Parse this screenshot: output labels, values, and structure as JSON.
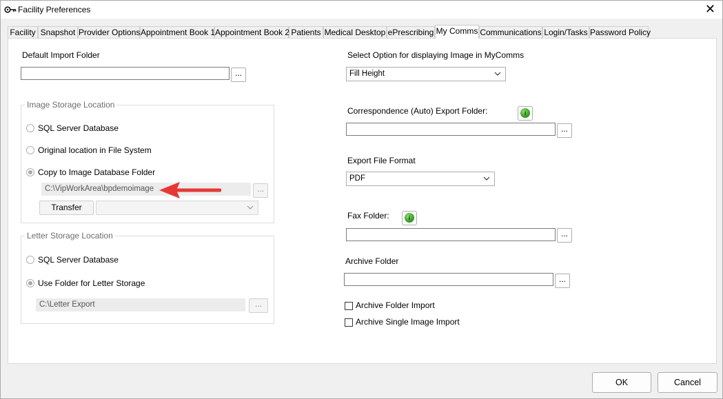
{
  "window": {
    "title": "Facility Preferences"
  },
  "tabs": [
    {
      "label": "Facility"
    },
    {
      "label": "Snapshot"
    },
    {
      "label": "Provider Options"
    },
    {
      "label": "Appointment Book 1"
    },
    {
      "label": "Appointment Book 2"
    },
    {
      "label": "Patients"
    },
    {
      "label": "Medical Desktop"
    },
    {
      "label": "ePrescribing"
    },
    {
      "label": "My Comms"
    },
    {
      "label": "Communications"
    },
    {
      "label": "Login/Tasks"
    },
    {
      "label": "Password Policy"
    }
  ],
  "left": {
    "default_import": {
      "label": "Default Import Folder",
      "value": "",
      "browse": "..."
    },
    "image_storage": {
      "title": "Image Storage Location",
      "options": [
        "SQL Server Database",
        "Original location in File System",
        "Copy to Image Database Folder"
      ],
      "selected": "Copy to Image Database Folder",
      "folder_value": "C:\\VipWorkArea\\bpdemoimage",
      "browse": "...",
      "transfer_label": "Transfer",
      "transfer_select": ""
    },
    "letter_storage": {
      "title": "Letter Storage Location",
      "options": [
        "SQL Server Database",
        "Use Folder for Letter Storage"
      ],
      "selected": "Use Folder for Letter Storage",
      "folder_value": "C:\\Letter Export",
      "browse": "..."
    }
  },
  "right": {
    "image_display": {
      "label": "Select Option for displaying Image in MyComms",
      "selected": "Fill Height"
    },
    "correspondence": {
      "label": "Correspondence (Auto) Export Folder:",
      "value": "",
      "browse": "..."
    },
    "export_format": {
      "label": "Export File Format",
      "selected": "PDF"
    },
    "fax": {
      "label": "Fax Folder:",
      "value": "",
      "browse": "..."
    },
    "archive": {
      "label": "Archive Folder",
      "value": "",
      "browse": "..."
    },
    "checkboxes": [
      {
        "label": "Archive Folder Import",
        "checked": false
      },
      {
        "label": "Archive Single Image Import",
        "checked": false
      }
    ],
    "info_glyph": "i"
  },
  "footer": {
    "ok": "OK",
    "cancel": "Cancel"
  },
  "colors": {
    "annotation_arrow": "#e53935",
    "info_green": "#3aa52a",
    "active_tab_bg": "#ffffff"
  }
}
